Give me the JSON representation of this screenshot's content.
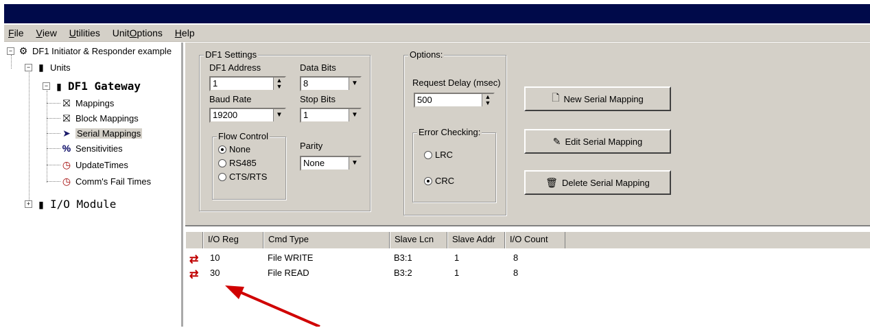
{
  "menu": {
    "items": [
      {
        "pre": "",
        "u": "F",
        "post": "ile"
      },
      {
        "pre": "",
        "u": "V",
        "post": "iew"
      },
      {
        "pre": "",
        "u": "U",
        "post": "tilities"
      },
      {
        "pre": "Unit ",
        "u": "O",
        "post": "ptions"
      },
      {
        "pre": "",
        "u": "H",
        "post": "elp"
      }
    ]
  },
  "tree": {
    "root": "DF1 Initiator & Responder example",
    "units": "Units",
    "gateway": "DF1 Gateway",
    "children": [
      "Mappings",
      "Block Mappings",
      "Serial Mappings",
      "Sensitivities",
      "UpdateTimes",
      "Comm's Fail Times"
    ],
    "io_module": "I/O Module"
  },
  "df1": {
    "legend": "DF1 Settings",
    "address_label": "DF1 Address",
    "address": "1",
    "databits_label": "Data Bits",
    "databits": "8",
    "baud_label": "Baud Rate",
    "baud": "19200",
    "stopbits_label": "Stop Bits",
    "stopbits": "1",
    "flow_legend": "Flow Control",
    "flow_options": [
      "None",
      "RS485",
      "CTS/RTS"
    ],
    "flow_selected": "None",
    "parity_label": "Parity",
    "parity": "None"
  },
  "options": {
    "legend": "Options:",
    "request_delay_label": "Request Delay (msec)",
    "request_delay": "500",
    "error_legend": "Error Checking:",
    "lrc": "LRC",
    "crc": "CRC",
    "selected": "CRC"
  },
  "buttons": {
    "new": "New Serial Mapping",
    "edit": "Edit Serial Mapping",
    "delete": "Delete Serial Mapping"
  },
  "grid": {
    "columns": [
      "I/O Reg",
      "Cmd Type",
      "Slave Lcn",
      "Slave Addr",
      "I/O Count"
    ],
    "rows": [
      {
        "reg": "10",
        "cmd": "File WRITE",
        "lcn": "B3:1",
        "addr": "1",
        "count": "8"
      },
      {
        "reg": "30",
        "cmd": "File READ",
        "lcn": "B3:2",
        "addr": "1",
        "count": "8"
      }
    ]
  },
  "colors": {
    "titlebar": "#000a4a",
    "annotation_arrow": "#d00000",
    "row_icon": "#c00000"
  }
}
